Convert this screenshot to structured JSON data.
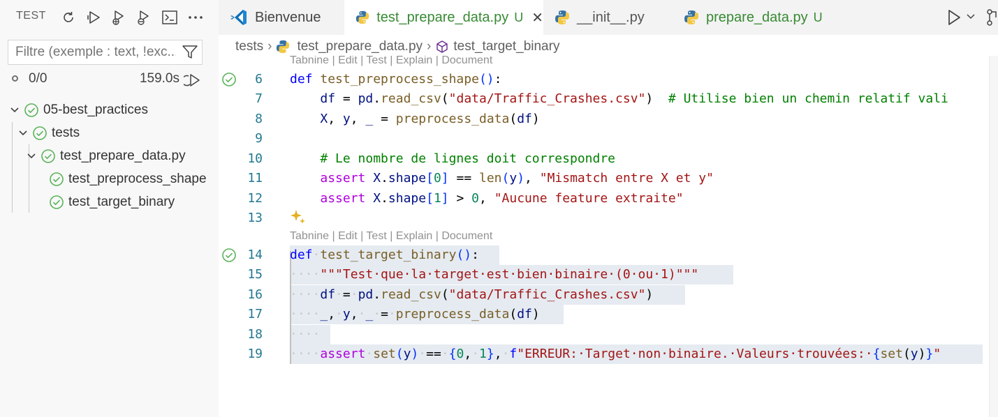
{
  "sidebar": {
    "title": "TEST",
    "filter_placeholder": "Filtre (exemple : text, !exc...",
    "status_count": "0/0",
    "status_time": "159.0s",
    "tree": [
      {
        "label": "05-best_practices"
      },
      {
        "label": "tests"
      },
      {
        "label": "test_prepare_data.py"
      },
      {
        "label": "test_preprocess_shape"
      },
      {
        "label": "test_target_binary"
      }
    ]
  },
  "tabs": [
    {
      "label": "Bienvenue"
    },
    {
      "label": "test_prepare_data.py",
      "badge": "U",
      "close": "✕"
    },
    {
      "label": "__init__.py"
    },
    {
      "label": "prepare_data.py",
      "badge": "U"
    }
  ],
  "breadcrumb": {
    "items": [
      "tests",
      "test_prepare_data.py",
      "test_target_binary"
    ],
    "separator": "›"
  },
  "editor": {
    "codelens": "Tabnine | Edit | Test | Explain | Document",
    "line_numbers": [
      "6",
      "7",
      "8",
      "9",
      "10",
      "11",
      "12",
      "13",
      "14",
      "15",
      "16",
      "17",
      "18",
      "19"
    ]
  },
  "colors": {
    "accent_blue": "#007acc",
    "modified_green": "#388a34",
    "pass_green": "#5ab35a",
    "selection": "#e5ebf1"
  }
}
